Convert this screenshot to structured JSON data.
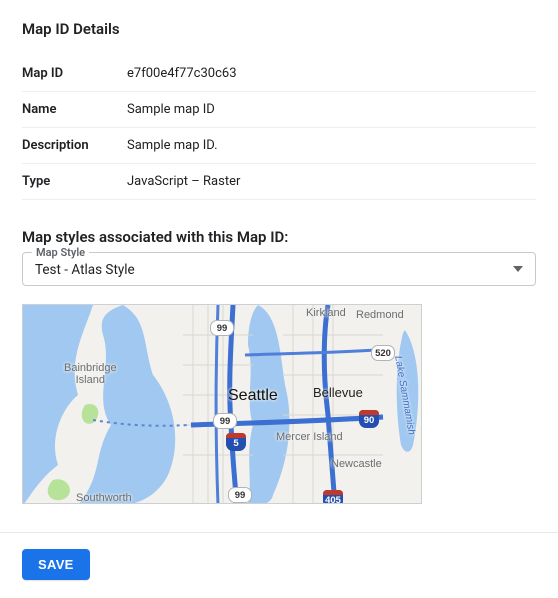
{
  "details": {
    "heading": "Map ID Details",
    "rows": {
      "map_id": {
        "label": "Map ID",
        "value": "e7f00e4f77c30c63"
      },
      "name": {
        "label": "Name",
        "value": "Sample map ID"
      },
      "description": {
        "label": "Description",
        "value": "Sample map ID."
      },
      "type": {
        "label": "Type",
        "value": "JavaScript – Raster"
      }
    }
  },
  "styles_section": {
    "heading": "Map styles associated with this Map ID:",
    "select_label": "Map Style",
    "selected_value": "Test - Atlas Style"
  },
  "map_preview": {
    "city_primary": "Seattle",
    "labels": {
      "kirkland": "Kirkland",
      "redmond": "Redmond",
      "bellevue": "Bellevue",
      "mercer": "Mercer Island",
      "newcastle": "Newcastle",
      "bainbridge": "Bainbridge\nIsland",
      "southworth": "Southworth",
      "sammamish": "Lake Sammamish"
    },
    "shields": {
      "wa99a": "99",
      "wa99b": "99",
      "wa99c": "99",
      "wa520": "520",
      "i5": "5",
      "i90": "90",
      "i405": "405"
    }
  },
  "footer": {
    "save_label": "SAVE"
  }
}
